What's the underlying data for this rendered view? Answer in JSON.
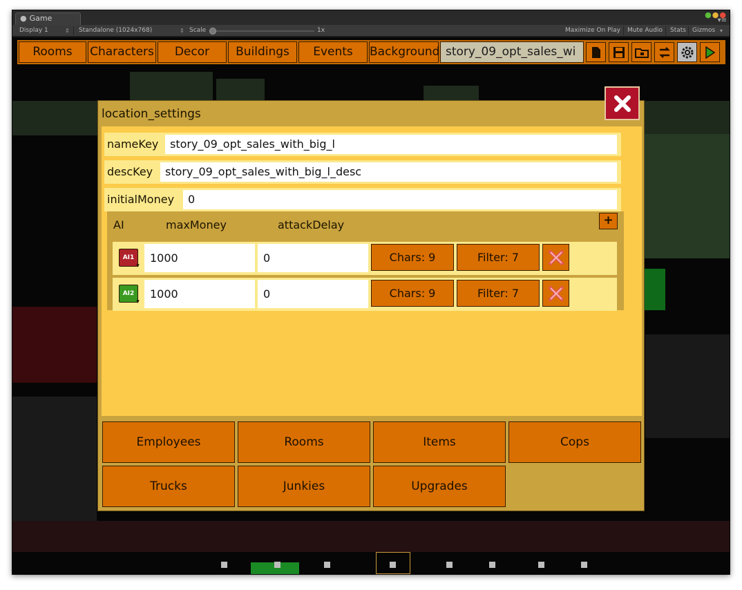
{
  "window": {
    "tab_title": "Game"
  },
  "toolbar": {
    "display": "Display 1",
    "resolution": "Standalone (1024x768)",
    "scale_label": "Scale",
    "scale_value": "1x",
    "maximize": "Maximize On Play",
    "mute": "Mute Audio",
    "stats": "Stats",
    "gizmos": "Gizmos"
  },
  "nav": {
    "tabs": [
      "Rooms",
      "Characters",
      "Decor",
      "Buildings",
      "Events",
      "Background"
    ],
    "active_tab": "story_09_opt_sales_wi",
    "icons": [
      "new-file-icon",
      "save-icon",
      "open-folder-icon",
      "swap-icon",
      "settings-gear-icon",
      "play-icon"
    ]
  },
  "dialog": {
    "title": "location_settings",
    "fields": [
      {
        "label": "nameKey",
        "value": "story_09_opt_sales_with_big_l"
      },
      {
        "label": "descKey",
        "value": "story_09_opt_sales_with_big_l_desc"
      },
      {
        "label": "initialMoney",
        "value": "0"
      }
    ],
    "ai_table": {
      "headers": [
        "AI",
        "maxMoney",
        "attackDelay"
      ],
      "add_label": "+",
      "rows": [
        {
          "badge": "AI1",
          "color": "#b0222a",
          "max_money": "1000",
          "attack_delay": "0",
          "chars": "Chars: 9",
          "filter": "Filter: 7"
        },
        {
          "badge": "AI2",
          "color": "#3a9a20",
          "max_money": "1000",
          "attack_delay": "0",
          "chars": "Chars: 9",
          "filter": "Filter: 7"
        }
      ]
    },
    "categories": [
      "Employees",
      "Rooms",
      "Items",
      "Cops",
      "Trucks",
      "Junkies",
      "Upgrades"
    ]
  },
  "colors": {
    "accent_orange": "#d96f00",
    "panel_gold": "#c9a33e",
    "panel_yellow": "#fccb4a",
    "close_red": "#b0122a"
  },
  "pager": {
    "page_count": 8,
    "selected_index": 3
  }
}
